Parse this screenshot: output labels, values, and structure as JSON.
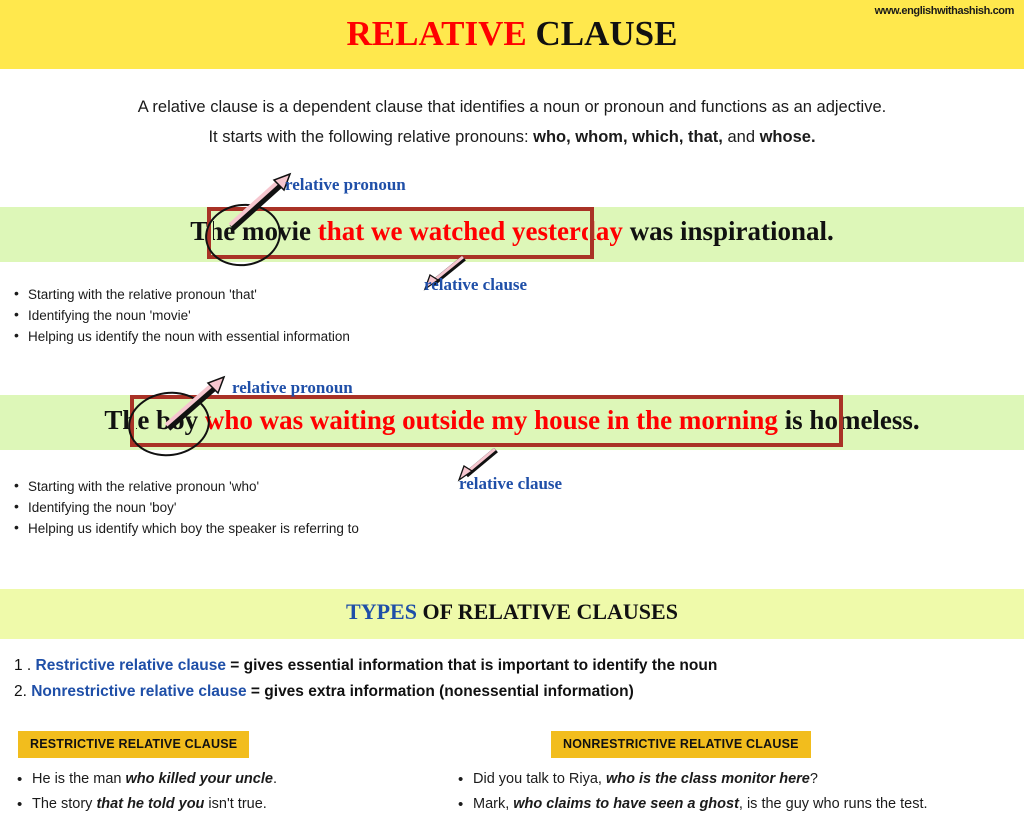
{
  "header": {
    "site_url": "www.englishwithashish.com",
    "title_highlight": "RELATIVE",
    "title_rest": " CLAUSE",
    "band_color": "#ffe84d",
    "highlight_color": "#ff0000"
  },
  "intro": {
    "line1": "A relative clause is a dependent clause that identifies a noun or pronoun and functions as an adjective.",
    "line2_prefix": "It starts with the following relative pronouns: ",
    "line2_pronouns": "who, whom, which, that,",
    "line2_and": " and ",
    "line2_last": "whose."
  },
  "examples": [
    {
      "before": "The movie ",
      "clause": "that we watched yesterday",
      "after": " was inspirational.",
      "pronoun_label": "relative pronoun",
      "clause_label": "relative clause",
      "band_color": "#ddf7b8",
      "box_color": "#a93226",
      "clause_color": "#ff0000",
      "bullets": [
        "Starting with the relative pronoun 'that'",
        "Identifying the noun 'movie'",
        "Helping us identify the noun with essential information"
      ]
    },
    {
      "before": "The boy ",
      "clause": "who was waiting outside my house in the morning",
      "after": " is homeless.",
      "pronoun_label": "relative pronoun",
      "clause_label": "relative clause",
      "band_color": "#ddf7b8",
      "box_color": "#a93226",
      "clause_color": "#ff0000",
      "bullets": [
        "Starting with the relative pronoun 'who'",
        "Identifying the noun 'boy'",
        "Helping us identify which boy the speaker is referring to"
      ]
    }
  ],
  "types_section": {
    "title_highlight": "TYPES",
    "title_rest": " OF RELATIVE CLAUSES",
    "band_color": "#effaaa",
    "accent_color": "#1f4fa8",
    "items": [
      {
        "number": "1 . ",
        "kind": "Restrictive relative clause",
        "definition": " = gives essential information that is important to identify the noun"
      },
      {
        "number": "2. ",
        "kind": "Nonrestrictive relative clause",
        "definition": " = gives extra information (nonessential information)"
      }
    ]
  },
  "columns": [
    {
      "badge": "RESTRICTIVE RELATIVE CLAUSE",
      "badge_color": "#f2bd1d",
      "examples": [
        {
          "pre": "He is the man ",
          "em": "who killed your uncle",
          "post": "."
        },
        {
          "pre": "The story ",
          "em": "that he told you",
          "post": " isn't true."
        }
      ]
    },
    {
      "badge": "NONRESTRICTIVE RELATIVE CLAUSE",
      "badge_color": "#f2bd1d",
      "examples": [
        {
          "pre": "Did you talk to Riya, ",
          "em": "who is the class monitor here",
          "post": "?"
        },
        {
          "pre": "Mark, ",
          "em": "who claims to have seen a ghost",
          "post": ", is the guy who runs the test."
        }
      ]
    }
  ]
}
